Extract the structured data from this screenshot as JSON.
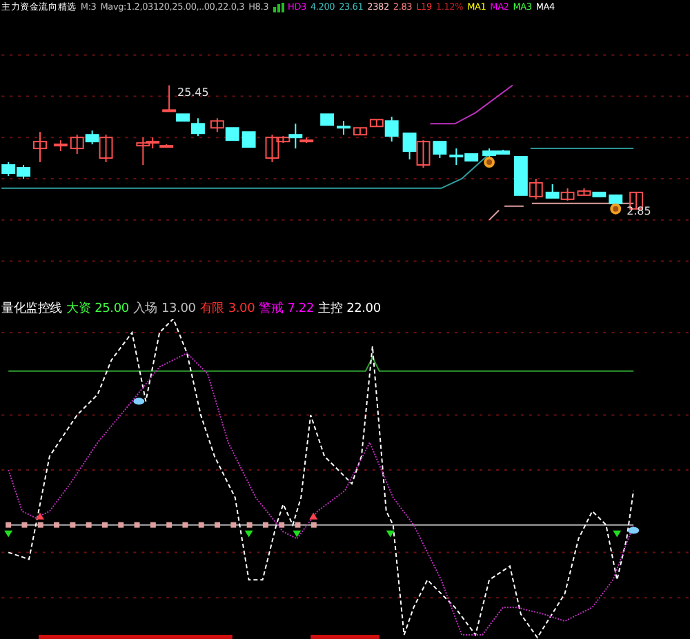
{
  "price_header": {
    "items": [
      {
        "text": "主力资金流向精选",
        "color": "#ffffff"
      },
      {
        "text": "M:3",
        "color": "#c0c0c0"
      },
      {
        "text": "Mavg:1.2,03120,25.00,..00,22.0,3",
        "color": "#c0c0c0"
      },
      {
        "text": "H8.3",
        "color": "#c0c0c0"
      },
      {
        "text": "HD3",
        "color": "#ff00ff"
      },
      {
        "text": "4.200",
        "color": "#40c0c0"
      },
      {
        "text": "23.61",
        "color": "#40c0c0"
      },
      {
        "text": "2382",
        "color": "#ffc0c0"
      },
      {
        "text": "2.83",
        "color": "#ff8080"
      },
      {
        "text": "L19",
        "color": "#ff3030"
      },
      {
        "text": "1.12%",
        "color": "#c02020"
      },
      {
        "text": "MA1",
        "color": "#ffff00"
      },
      {
        "text": "MA2",
        "color": "#ff00ff"
      },
      {
        "text": "MA3",
        "color": "#40ff40"
      },
      {
        "text": "MA4",
        "color": "#ffffff"
      }
    ]
  },
  "price_chart": {
    "annotations": [
      {
        "text": "25.45"
      },
      {
        "text": "2.85"
      }
    ]
  },
  "indicator_header": {
    "items": [
      {
        "text": "量化监控线",
        "color": "#ffffff"
      },
      {
        "text": "大资",
        "color": "#40ff40"
      },
      {
        "text": "25.00",
        "color": "#40ff40"
      },
      {
        "text": "入场",
        "color": "#c0c0c0"
      },
      {
        "text": "13.00",
        "color": "#c0c0c0"
      },
      {
        "text": "有限",
        "color": "#ff3030"
      },
      {
        "text": "3.00",
        "color": "#ff3030"
      },
      {
        "text": "警戒",
        "color": "#ff00ff"
      },
      {
        "text": "7.22",
        "color": "#ff00ff"
      },
      {
        "text": "主控",
        "color": "#ffffff"
      },
      {
        "text": "22.00",
        "color": "#ffffff"
      }
    ]
  }
}
